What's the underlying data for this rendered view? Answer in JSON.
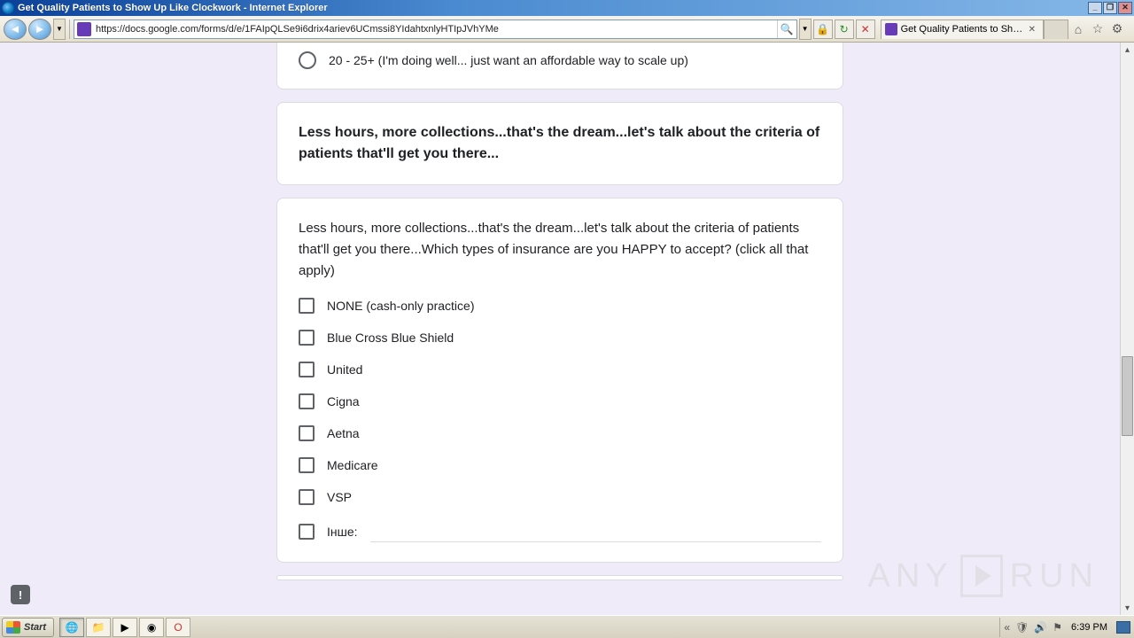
{
  "window": {
    "title": "Get Quality Patients to Show Up Like Clockwork - Internet Explorer"
  },
  "toolbar": {
    "url": "https://docs.google.com/forms/d/e/1FAIpQLSe9i6drix4ariev6UCmssi8YIdahtxnlyHTIpJVhYMe"
  },
  "tab": {
    "title": "Get Quality Patients to Show..."
  },
  "form": {
    "radio_option": "20 - 25+ (I'm doing well... just want an affordable way to scale up)",
    "section_header": "Less hours, more collections...that's the dream...let's talk about the criteria of patients that'll get you there...",
    "question": "Less hours, more collections...that's the dream...let's talk about the criteria of patients that'll get you there...Which types of insurance are you HAPPY to accept? (click all that apply)",
    "checkboxes": [
      "NONE (cash-only practice)",
      "Blue Cross Blue Shield",
      "United",
      "Cigna",
      "Aetna",
      "Medicare",
      "VSP"
    ],
    "other_label": "Інше:"
  },
  "watermark": {
    "left": "ANY",
    "right": "RUN"
  },
  "taskbar": {
    "start": "Start",
    "clock": "6:39 PM"
  }
}
